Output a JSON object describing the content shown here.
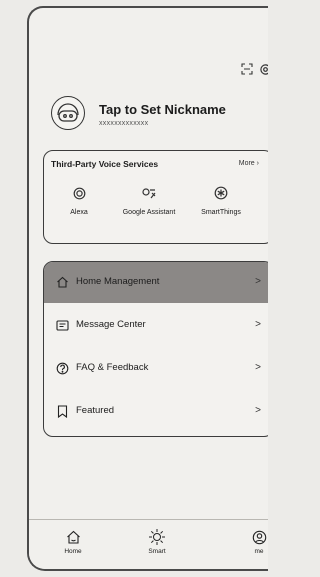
{
  "profile": {
    "nickname": "Tap to Set Nickname",
    "account_id": "xxxxxxxxxxxxx"
  },
  "voice_services": {
    "title": "Third-Party Voice Services",
    "more_label": "More",
    "services": [
      {
        "label": "Alexa",
        "icon": "alexa-icon"
      },
      {
        "label": "Google Assistant",
        "icon": "google-assistant-icon"
      },
      {
        "label": "SmartThings",
        "icon": "smartthings-icon"
      }
    ]
  },
  "menu": {
    "items": [
      {
        "label": "Home Management",
        "icon": "home-icon",
        "active": true
      },
      {
        "label": "Message Center",
        "icon": "message-icon",
        "active": false
      },
      {
        "label": "FAQ & Feedback",
        "icon": "question-icon",
        "active": false
      },
      {
        "label": "Featured",
        "icon": "bookmark-icon",
        "active": false
      }
    ],
    "chevron": ">"
  },
  "tabbar": {
    "tabs": [
      {
        "label": "Home",
        "icon": "home-icon"
      },
      {
        "label": "Smart",
        "icon": "sun-icon"
      },
      {
        "label": "me",
        "icon": "me-icon"
      }
    ]
  },
  "colors": {
    "active_row": "#8b8886",
    "card_border": "#3c3c3c",
    "background": "#f1f0ed"
  },
  "icons": {
    "top_bar": [
      "scan-icon",
      "settings-icon"
    ],
    "avatar": "avatar-face-icon"
  }
}
